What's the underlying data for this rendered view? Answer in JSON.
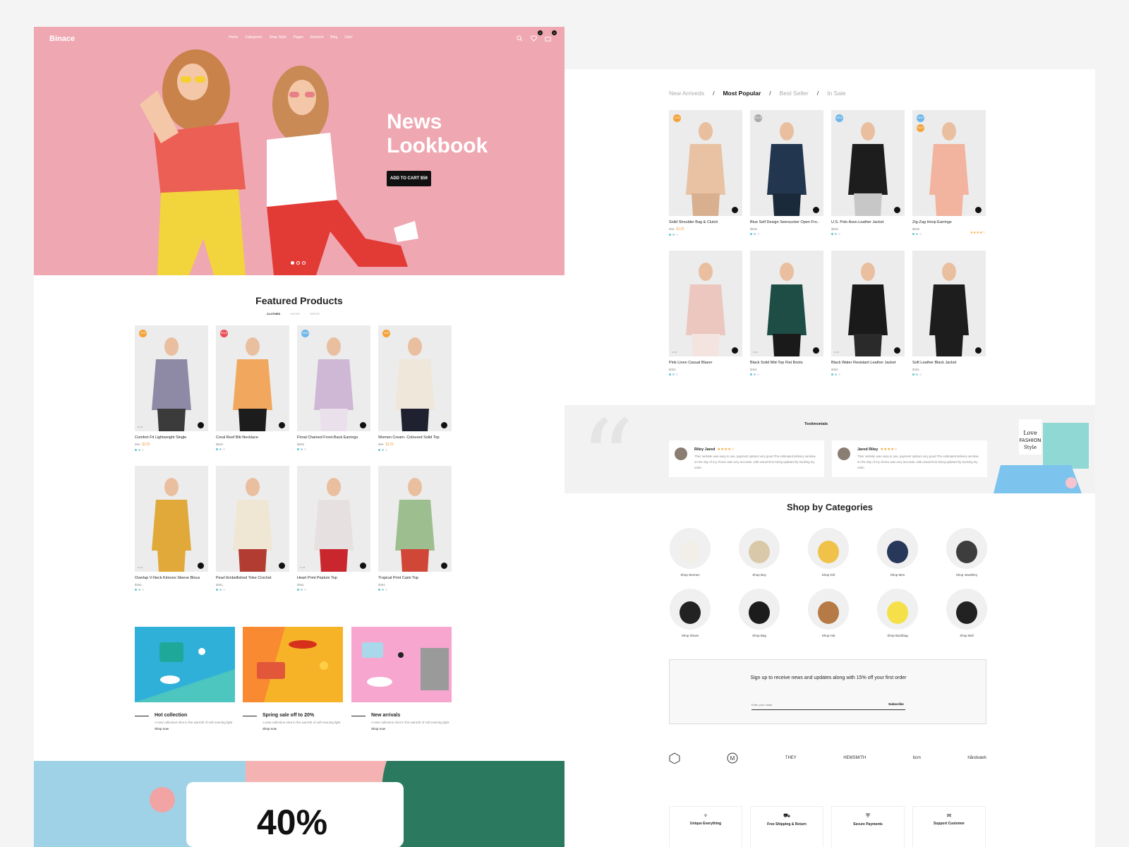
{
  "brand": "Binace",
  "nav": [
    "Home",
    "Categories",
    "Shop Style",
    "Pages",
    "Element",
    "Blog",
    "Sale!"
  ],
  "header_badges": {
    "wishlist": "0",
    "cart": "0"
  },
  "hero": {
    "title": "News Lookbook",
    "button": "ADD TO CART $59",
    "slides": 3,
    "active_slide": 0
  },
  "featured": {
    "title": "Featured Products",
    "tabs": [
      "CLOTHES",
      "SHOES",
      "DRESS"
    ],
    "products": [
      {
        "name": "Comfort Fit Lightweight Single",
        "old": "$62",
        "price": "$125",
        "tag": "-10%",
        "tagc": "#f4a33a",
        "size": "S / M"
      },
      {
        "name": "Coral Reef Bib Necklace",
        "price": "$526",
        "tag": "SOLD",
        "tagc": "#e9505a"
      },
      {
        "name": "Floral Chained Front-Back Earrings",
        "price": "$605",
        "tag": "NEW",
        "tagc": "#6fb6ea"
      },
      {
        "name": "Women Cream- Coloured Solid Top",
        "old": "$62",
        "price": "$125",
        "tag": "-10%",
        "tagc": "#f4a33a"
      },
      {
        "name": "Overlap V-Neck Kimono Sleeve Blous",
        "price": "$461",
        "size": "S / M"
      },
      {
        "name": "Pearl Embellished Yoke Crochet",
        "price": "$461"
      },
      {
        "name": "Heart Print Peplum Top",
        "price": "$461",
        "size": "S / M"
      },
      {
        "name": "Tropical Print Cami Top",
        "price": "$461"
      }
    ]
  },
  "promos": [
    {
      "title": "Hot collection",
      "desc": "A new collection shot in the warmth of soft evening light",
      "link": "Shop now"
    },
    {
      "title": "Spring sale off to 20%",
      "desc": "A new collection shot in the warmth of soft evening light",
      "link": "Shop now"
    },
    {
      "title": "New arrivals",
      "desc": "A new collection shot in the warmth of soft evening light",
      "link": "Shop now"
    }
  ],
  "sale": {
    "percent": "40%"
  },
  "tabs": [
    "New Arriveds",
    "Most Popular",
    "Best Seller",
    "In Sale"
  ],
  "active_tab": "Most Popular",
  "popular": [
    {
      "name": "Solid Shoulder Bag & Clutch",
      "old": "$62",
      "price": "$125",
      "tag": "-10%",
      "tagc": "#f4a33a"
    },
    {
      "name": "Blue Self Design Seersucker Open Fro..",
      "price": "$526",
      "tag": "SOLD",
      "tagc": "#aaaaaa"
    },
    {
      "name": "U.S. Polo Assn.Leather Jacket",
      "price": "$605",
      "tag": "NEW",
      "tagc": "#6fb6ea"
    },
    {
      "name": "Zig-Zag Hoop Earrings",
      "price": "$639",
      "tag": "NEW",
      "tagc": "#6fb6ea",
      "tag2": "SALE",
      "rating": "★★★★☆"
    },
    {
      "name": "Pink Linen Casual Blazer",
      "price": "$461",
      "size": "S / M"
    },
    {
      "name": "Black Solid Mid-Top Flat Boots",
      "price": "$461",
      "size": "S / M"
    },
    {
      "name": "Black Water Resistant Leather Jacket",
      "price": "$461",
      "size": "S / M"
    },
    {
      "name": "Soft Leather Black Jacket",
      "price": "$461"
    }
  ],
  "testimonials": {
    "title": "Testimonials",
    "items": [
      {
        "name": "Riley Jared",
        "stars": "★★★★☆",
        "text": "Their website was easy to use, payment options very good.The estimated delivery window, on the day of my choice was very accurate, with actual time being updated by tracking my order"
      },
      {
        "name": "Jared Riley",
        "stars": "★★★★☆",
        "text": "Their website was easy to use, payment options very good.The estimated delivery window, on the day of my choice was very accurate, with actual time being updated by tracking my order"
      }
    ],
    "deco_text": "Love FASHION Style"
  },
  "categories": {
    "title": "Shop by Categories",
    "items": [
      "Shop Women",
      "Shop Boy",
      "Shop Girl",
      "Shop Men",
      "Shop Jewellery",
      "Shop Shoes",
      "Shop Bag",
      "Shop Hat",
      "Shop Backbag",
      "Shop Belt"
    ]
  },
  "newsletter": {
    "text": "Sign up to receive news and updates along with 15% off your first order",
    "placeholder": "Enter your email",
    "button": "Subscribe"
  },
  "brands": [
    "THEY",
    "HEMSMITH",
    "bcm",
    "håndværk"
  ],
  "features": [
    "Unique Everything",
    "Free Shipping & Return",
    "Secure Payments",
    "Support Customer"
  ]
}
